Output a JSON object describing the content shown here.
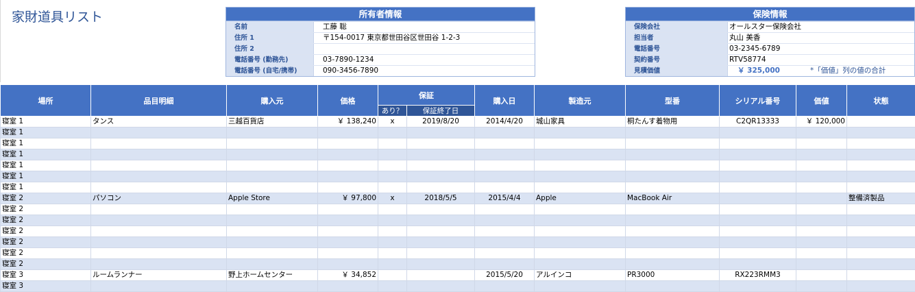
{
  "title": "家財道具リスト",
  "owner": {
    "heading": "所有者情報",
    "rows": [
      {
        "label": "名前",
        "value": "工藤 聡"
      },
      {
        "label": "住所 1",
        "value": "〒154-0017 東京都世田谷区世田谷 1-2-3"
      },
      {
        "label": "住所 2",
        "value": ""
      },
      {
        "label": "電話番号 (勤務先)",
        "value": "03-7890-1234"
      },
      {
        "label": "電話番号 (自宅/携帯)",
        "value": "090-3456-7890"
      }
    ]
  },
  "insurance": {
    "heading": "保険情報",
    "rows": [
      {
        "label": "保険会社",
        "value": "オールスター保険会社"
      },
      {
        "label": "担当者",
        "value": "丸山 美香"
      },
      {
        "label": "電話番号",
        "value": "03-2345-6789"
      },
      {
        "label": "契約番号",
        "value": "RTV58774"
      }
    ],
    "estimate_label": "見積価値",
    "estimate_value": "￥ 325,000",
    "estimate_note": "*「価値」列の値の合計"
  },
  "columns": {
    "location": "場所",
    "item": "品目明細",
    "vendor": "購入元",
    "price": "価格",
    "warranty": "保証",
    "warranty_has": "あり？",
    "warranty_end": "保証終了日",
    "purchase_date": "購入日",
    "maker": "製造元",
    "model": "型番",
    "serial": "シリアル番号",
    "value": "価値",
    "condition": "状態"
  },
  "rows": [
    {
      "location": "寝室 1",
      "item": "タンス",
      "vendor": "三越百貨店",
      "price": "￥ 138,240",
      "has": "x",
      "end": "2019/8/20",
      "date": "2014/4/20",
      "maker": "城山家具",
      "model": "桐たんす着物用",
      "serial": "C2QR13333",
      "value": "￥ 120,000",
      "condition": ""
    },
    {
      "location": "寝室 1",
      "item": "",
      "vendor": "",
      "price": "",
      "has": "",
      "end": "",
      "date": "",
      "maker": "",
      "model": "",
      "serial": "",
      "value": "",
      "condition": ""
    },
    {
      "location": "寝室 1",
      "item": "",
      "vendor": "",
      "price": "",
      "has": "",
      "end": "",
      "date": "",
      "maker": "",
      "model": "",
      "serial": "",
      "value": "",
      "condition": ""
    },
    {
      "location": "寝室 1",
      "item": "",
      "vendor": "",
      "price": "",
      "has": "",
      "end": "",
      "date": "",
      "maker": "",
      "model": "",
      "serial": "",
      "value": "",
      "condition": ""
    },
    {
      "location": "寝室 1",
      "item": "",
      "vendor": "",
      "price": "",
      "has": "",
      "end": "",
      "date": "",
      "maker": "",
      "model": "",
      "serial": "",
      "value": "",
      "condition": ""
    },
    {
      "location": "寝室 1",
      "item": "",
      "vendor": "",
      "price": "",
      "has": "",
      "end": "",
      "date": "",
      "maker": "",
      "model": "",
      "serial": "",
      "value": "",
      "condition": ""
    },
    {
      "location": "寝室 1",
      "item": "",
      "vendor": "",
      "price": "",
      "has": "",
      "end": "",
      "date": "",
      "maker": "",
      "model": "",
      "serial": "",
      "value": "",
      "condition": ""
    },
    {
      "location": "寝室 2",
      "item": "パソコン",
      "vendor": "Apple Store",
      "price": "￥ 97,800",
      "has": "x",
      "end": "2018/5/5",
      "date": "2015/4/4",
      "maker": "Apple",
      "model": "MacBook Air",
      "serial": "",
      "value": "",
      "condition": "整備済製品"
    },
    {
      "location": "寝室 2",
      "item": "",
      "vendor": "",
      "price": "",
      "has": "",
      "end": "",
      "date": "",
      "maker": "",
      "model": "",
      "serial": "",
      "value": "",
      "condition": ""
    },
    {
      "location": "寝室 2",
      "item": "",
      "vendor": "",
      "price": "",
      "has": "",
      "end": "",
      "date": "",
      "maker": "",
      "model": "",
      "serial": "",
      "value": "",
      "condition": ""
    },
    {
      "location": "寝室 2",
      "item": "",
      "vendor": "",
      "price": "",
      "has": "",
      "end": "",
      "date": "",
      "maker": "",
      "model": "",
      "serial": "",
      "value": "",
      "condition": ""
    },
    {
      "location": "寝室 2",
      "item": "",
      "vendor": "",
      "price": "",
      "has": "",
      "end": "",
      "date": "",
      "maker": "",
      "model": "",
      "serial": "",
      "value": "",
      "condition": ""
    },
    {
      "location": "寝室 2",
      "item": "",
      "vendor": "",
      "price": "",
      "has": "",
      "end": "",
      "date": "",
      "maker": "",
      "model": "",
      "serial": "",
      "value": "",
      "condition": ""
    },
    {
      "location": "寝室 2",
      "item": "",
      "vendor": "",
      "price": "",
      "has": "",
      "end": "",
      "date": "",
      "maker": "",
      "model": "",
      "serial": "",
      "value": "",
      "condition": ""
    },
    {
      "location": "寝室 3",
      "item": "ルームランナー",
      "vendor": "野上ホームセンター",
      "price": "￥ 34,852",
      "has": "",
      "end": "",
      "date": "2015/5/20",
      "maker": "アルインコ",
      "model": "PR3000",
      "serial": "RX223RMM3",
      "value": "",
      "condition": ""
    },
    {
      "location": "寝室 3",
      "item": "",
      "vendor": "",
      "price": "",
      "has": "",
      "end": "",
      "date": "",
      "maker": "",
      "model": "",
      "serial": "",
      "value": "",
      "condition": ""
    }
  ]
}
